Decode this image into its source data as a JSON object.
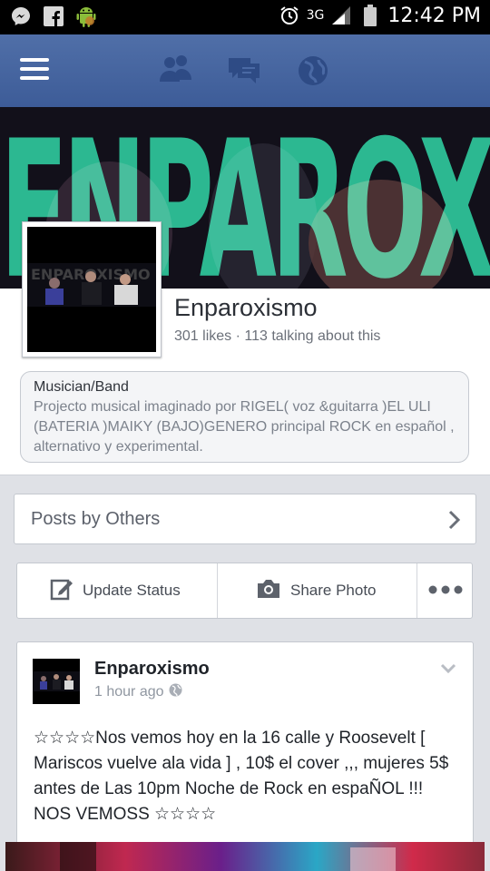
{
  "status_bar": {
    "time": "12:42 PM",
    "network": "3G",
    "icons": [
      "messenger-icon",
      "facebook-icon",
      "android-icon",
      "alarm-icon",
      "signal-icon",
      "battery-icon"
    ]
  },
  "app_bar": {
    "icons": [
      "menu-icon",
      "friend-requests-icon",
      "messages-icon",
      "notifications-globe-icon"
    ],
    "color": "#4a69a4"
  },
  "cover": {
    "text": "ENPAROXISMO"
  },
  "page": {
    "name": "Enparoxismo",
    "stats": "301 likes · 113 talking about this",
    "category": "Musician/Band",
    "description": "Projecto musical imaginado por RIGEL( voz &guitarra )EL ULI (BATERIA )MAIKY (BAJO)GENERO principal ROCK en español , alternativo  y experimental."
  },
  "posts_by_others": {
    "label": "Posts by Others"
  },
  "actions": {
    "update_status": "Update Status",
    "share_photo": "Share Photo"
  },
  "post": {
    "author": "Enparoxismo",
    "time": "1 hour ago",
    "text": "☆☆☆☆Nos vemos hoy en la 16 calle y Roosevelt [ Mariscos vuelve ala vida ] , 10$ el cover ,,, mujeres 5$ antes de Las 10pm Noche de Rock en espaÑOL !!!  NOS VEMOSS ☆☆☆☆"
  }
}
